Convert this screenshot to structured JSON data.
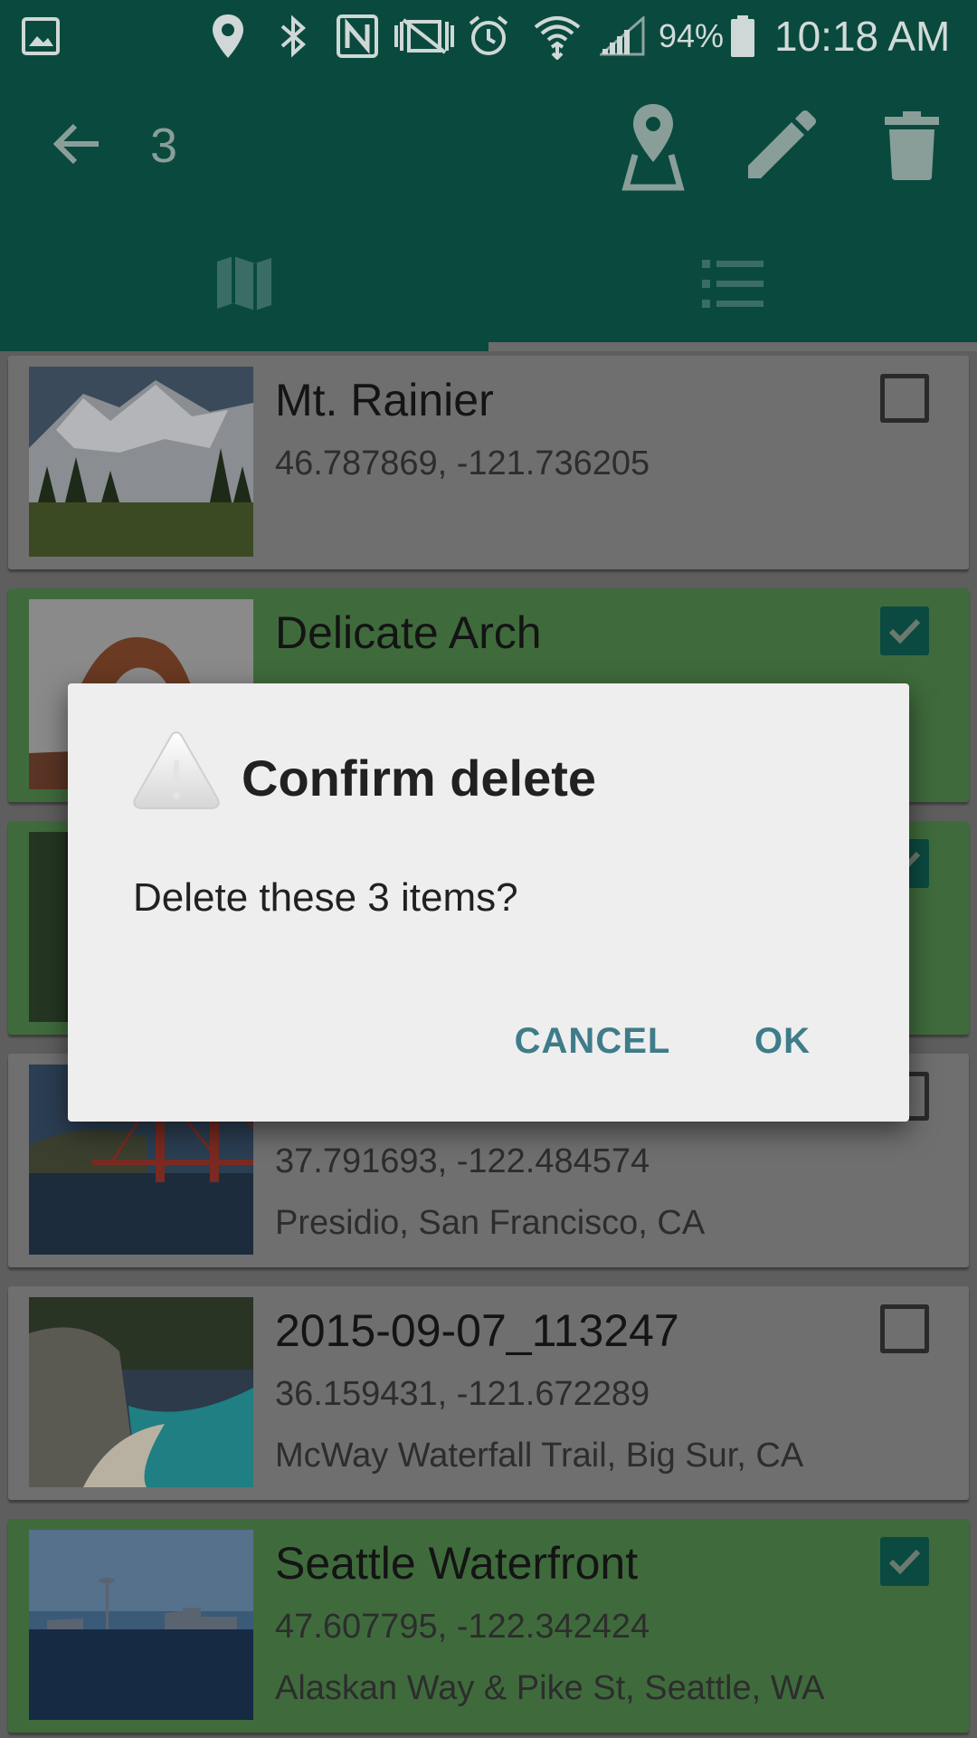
{
  "status_bar": {
    "battery": "94%",
    "time": "10:18 AM",
    "icons": [
      "image-icon",
      "location-pin-icon",
      "bluetooth-icon",
      "nfc-icon",
      "vibrate-mute-icon",
      "alarm-icon",
      "wifi-icon",
      "cell-signal-icon",
      "battery-icon"
    ]
  },
  "app_bar": {
    "selected_count": "3",
    "icons": [
      "back-arrow-icon",
      "map-pin-icon",
      "edit-icon",
      "delete-icon"
    ]
  },
  "tabs": [
    {
      "icon": "map-icon",
      "active": false
    },
    {
      "icon": "list-icon",
      "active": true
    }
  ],
  "items": [
    {
      "title": "Mt. Rainier",
      "coords": "46.787869, -121.736205",
      "address": "",
      "selected": false
    },
    {
      "title": "Delicate Arch",
      "coords": "",
      "address": "",
      "selected": true
    },
    {
      "title": "",
      "coords": "",
      "address": "",
      "selected": true
    },
    {
      "title": "",
      "coords": "37.791693, -122.484574",
      "address": "Presidio, San Francisco, CA",
      "selected": false
    },
    {
      "title": "2015-09-07_113247",
      "coords": "36.159431, -121.672289",
      "address": "McWay Waterfall Trail, Big Sur, CA",
      "selected": false
    },
    {
      "title": "Seattle Waterfront",
      "coords": "47.607795, -122.342424",
      "address": "Alaskan Way & Pike St, Seattle, WA",
      "selected": true
    }
  ],
  "dialog": {
    "icon": "warning-icon",
    "title": "Confirm delete",
    "message": "Delete these 3 items?",
    "cancel_label": "CANCEL",
    "ok_label": "OK"
  },
  "colors": {
    "primary_dark": "#0a4a3e",
    "selected_row": "#3f6b3c",
    "accent_button": "#3e7c8a"
  }
}
